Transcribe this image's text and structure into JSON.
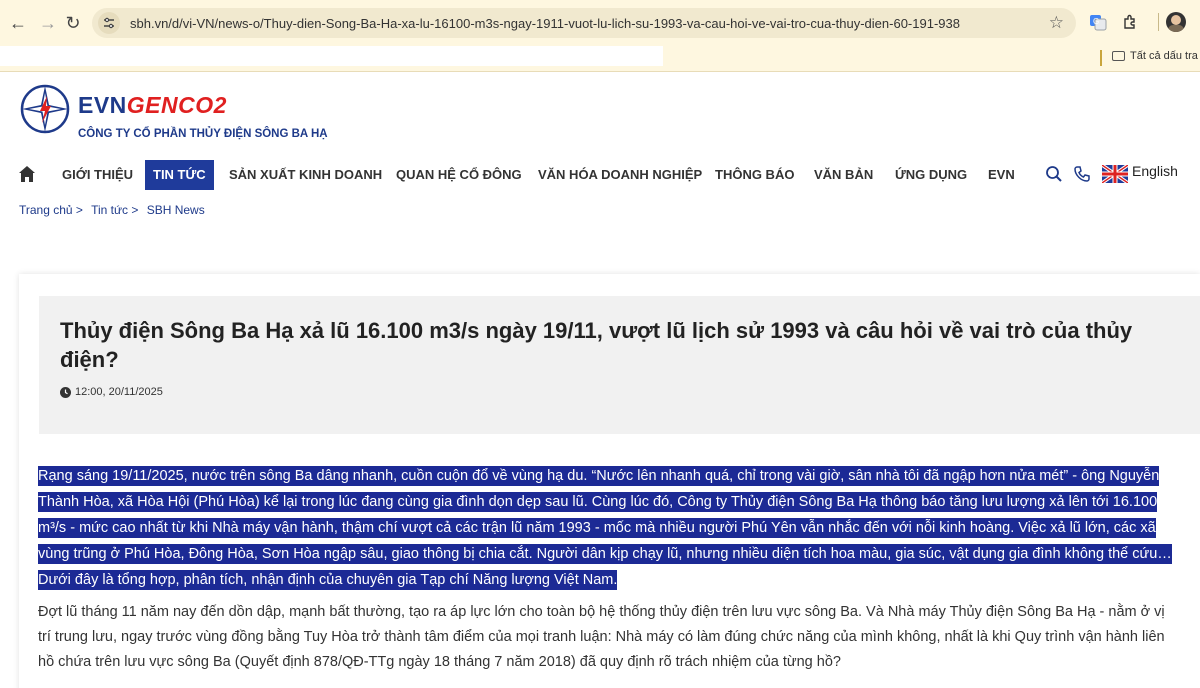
{
  "browser": {
    "url": "sbh.vn/d/vi-VN/news-o/Thuy-dien-Song-Ba-Ha-xa-lu-16100-m3s-ngay-1911-vuot-lu-lich-su-1993-va-cau-hoi-ve-vai-tro-cua-thuy-dien-60-191-938",
    "bookmarks_all": "Tất cả dấu tra"
  },
  "site": {
    "brand_evn": "EVN",
    "brand_genco": "GENCO2",
    "company": "CÔNG TY CỔ PHẦN THỦY ĐIỆN SÔNG BA HẠ",
    "accent": "#1f3b9b",
    "brand_red": "#e02020"
  },
  "nav": {
    "items": [
      "GIỚI THIỆU",
      "TIN TỨC",
      "SẢN XUẤT KINH DOANH",
      "QUAN HỆ CỔ ĐÔNG",
      "VĂN HÓA DOANH NGHIỆP",
      "THÔNG BÁO",
      "VĂN BẢN",
      "ỨNG DỤNG",
      "EVN"
    ],
    "active": "TIN TỨC",
    "language": "English"
  },
  "breadcrumb": [
    "Trang chủ >",
    "Tin tức >",
    "SBH News"
  ],
  "article": {
    "title": "Thủy điện Sông Ba Hạ xả lũ 16.100 m3/s ngày 19/11, vượt lũ lịch sử 1993 và câu hỏi về vai trò của thủy điện?",
    "datetime": "12:00, 20/11/2025",
    "lead": "Rạng sáng 19/11/2025, nước trên sông Ba dâng nhanh, cuồn cuộn đổ về vùng hạ du. “Nước lên nhanh quá, chỉ trong vài giờ, sân nhà tôi đã ngập hơn nửa mét” - ông Nguyễn Thành Hòa, xã Hòa Hội (Phú Hòa) kể lại trong lúc đang cùng gia đình dọn dẹp sau lũ. Cùng lúc đó, Công ty Thủy điện Sông Ba Hạ thông báo tăng lưu lượng xả lên tới 16.100 m³/s - mức cao nhất từ khi Nhà máy vận hành, thậm chí vượt cả các trận lũ năm 1993 - mốc mà nhiều người Phú Yên vẫn nhắc đến với nỗi kinh hoàng. Việc xả lũ lớn, các xã vùng trũng ở Phú Hòa, Đông Hòa, Sơn Hòa ngập sâu, giao thông bị chia cắt. Người dân kịp chạy lũ, nhưng nhiều diện tích hoa màu, gia súc, vật dụng gia đình không thể cứu… Dưới đây là tổng hợp, phân tích, nhận định của chuyên gia Tạp chí Năng lượng Việt Nam.",
    "paragraph": "Đợt lũ tháng 11 năm nay đến dồn dập, mạnh bất thường, tạo ra áp lực lớn cho toàn bộ hệ thống thủy điện trên lưu vực sông Ba. Và Nhà máy Thủy điện Sông Ba Hạ - nằm ở vị trí trung lưu, ngay trước vùng đồng bằng Tuy Hòa trở thành tâm điểm của mọi tranh luận: Nhà máy có làm đúng chức năng của mình không, nhất là khi Quy trình vận hành liên hồ chứa trên lưu vực sông Ba (Quyết định 878/QĐ-TTg ngày 18 tháng 7 năm 2018) đã quy định rõ trách nhiệm của từng hồ?"
  }
}
